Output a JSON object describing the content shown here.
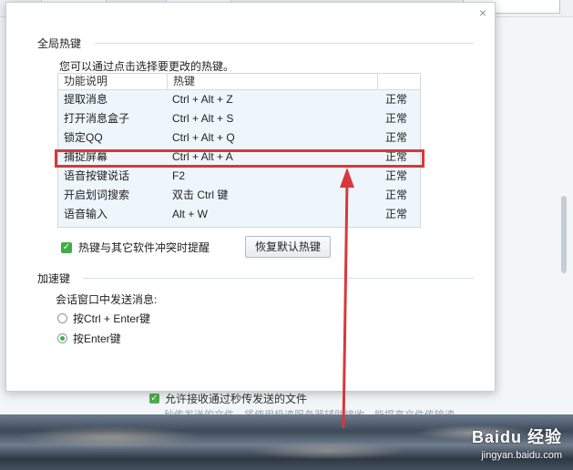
{
  "background": {
    "checkbox_label": "允许接收通过秒传发送的文件",
    "description": "秒传发送的文件，将使用极速服务器辅助接收，能提高文件传输速",
    "watermark": {
      "logo": "Baidu 经验",
      "url": "jingyan.baidu.com"
    }
  },
  "dialog": {
    "close_icon": "×",
    "global_hotkeys": {
      "title": "全局热键",
      "hint": "您可以通过点击选择要更改的热键。",
      "columns": [
        "功能说明",
        "热键",
        ""
      ],
      "rows": [
        {
          "func": "提取消息",
          "key": "Ctrl + Alt + Z",
          "status": "正常"
        },
        {
          "func": "打开消息盒子",
          "key": "Ctrl + Alt + S",
          "status": "正常"
        },
        {
          "func": "锁定QQ",
          "key": "Ctrl + Alt + Q",
          "status": "正常"
        },
        {
          "func": "捕捉屏幕",
          "key": "Ctrl + Alt + A",
          "status": "正常"
        },
        {
          "func": "语音按键说话",
          "key": "F2",
          "status": "正常"
        },
        {
          "func": "开启划词搜索",
          "key": "双击 Ctrl 键",
          "status": "正常"
        },
        {
          "func": "语音输入",
          "key": "Alt + W",
          "status": "正常"
        }
      ],
      "conflict_checkbox": {
        "label": "热键与其它软件冲突时提醒",
        "checked": true
      },
      "restore_button": "恢复默认热键"
    },
    "accelerator": {
      "title": "加速键",
      "subtitle": "会话窗口中发送消息:",
      "options": [
        {
          "label": "按Ctrl + Enter键",
          "checked": false
        },
        {
          "label": "按Enter键",
          "checked": true
        }
      ]
    }
  },
  "colors": {
    "accent_green": "#3fae49",
    "highlight_red": "#d8383c"
  }
}
